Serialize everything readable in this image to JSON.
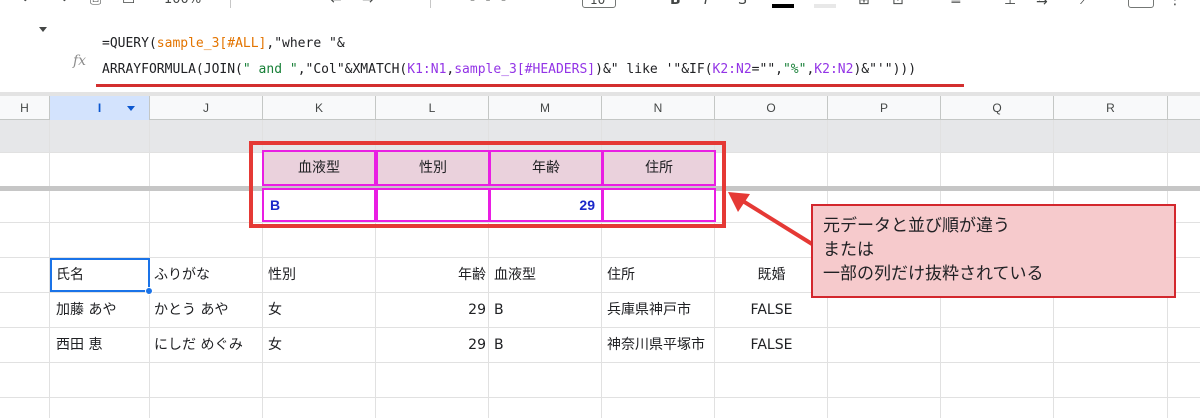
{
  "toolbar": {
    "zoom": "100%",
    "font_size": "10"
  },
  "formula_bar": {
    "fx_label": "fx",
    "line1": [
      {
        "text": "=QUERY(",
        "color": "default"
      },
      {
        "text": "sample_3[#ALL]",
        "color": "orange"
      },
      {
        "text": ",\"where \"&",
        "color": "default"
      }
    ],
    "line2": [
      {
        "text": "ARRAYFORMULA(JOIN(",
        "color": "default"
      },
      {
        "text": "\" and \"",
        "color": "green"
      },
      {
        "text": ",\"Col\"&XMATCH(",
        "color": "default"
      },
      {
        "text": "K1:N1",
        "color": "purple"
      },
      {
        "text": ",",
        "color": "default"
      },
      {
        "text": "sample_3[#HEADERS]",
        "color": "purple"
      },
      {
        "text": ")&\" like '\"&IF(",
        "color": "default"
      },
      {
        "text": "K2:N2",
        "color": "purple"
      },
      {
        "text": "=\"\",",
        "color": "default"
      },
      {
        "text": "\"%\"",
        "color": "green"
      },
      {
        "text": ",",
        "color": "default"
      },
      {
        "text": "K2:N2",
        "color": "purple"
      },
      {
        "text": ")&\"'\")))",
        "color": "default"
      }
    ]
  },
  "columns": [
    "H",
    "I",
    "J",
    "K",
    "L",
    "M",
    "N",
    "O",
    "P",
    "Q",
    "R"
  ],
  "selected_column": "I",
  "criteria": {
    "headers": [
      "血液型",
      "性別",
      "年齢",
      "住所"
    ],
    "values": [
      "B",
      "",
      "29",
      ""
    ]
  },
  "table": {
    "headers": [
      "氏名",
      "ふりがな",
      "性別",
      "年齢",
      "血液型",
      "住所",
      "既婚"
    ],
    "rows": [
      [
        "加藤 あや",
        "かとう あや",
        "女",
        "29",
        "B",
        "兵庫県神戸市",
        "FALSE"
      ],
      [
        "西田 恵",
        "にしだ めぐみ",
        "女",
        "29",
        "B",
        "神奈川県平塚市",
        "FALSE"
      ]
    ]
  },
  "annotation": {
    "lines": [
      "元データと並び順が違う",
      "または",
      "一部の列だけ抜粋されている"
    ]
  },
  "colors": {
    "accent_red": "#e53935",
    "criteria_border": "#e91ee3",
    "criteria_header_bg": "#ead1dc",
    "selection_blue": "#1a73e8",
    "criteria_value_text": "#1a27c9"
  }
}
